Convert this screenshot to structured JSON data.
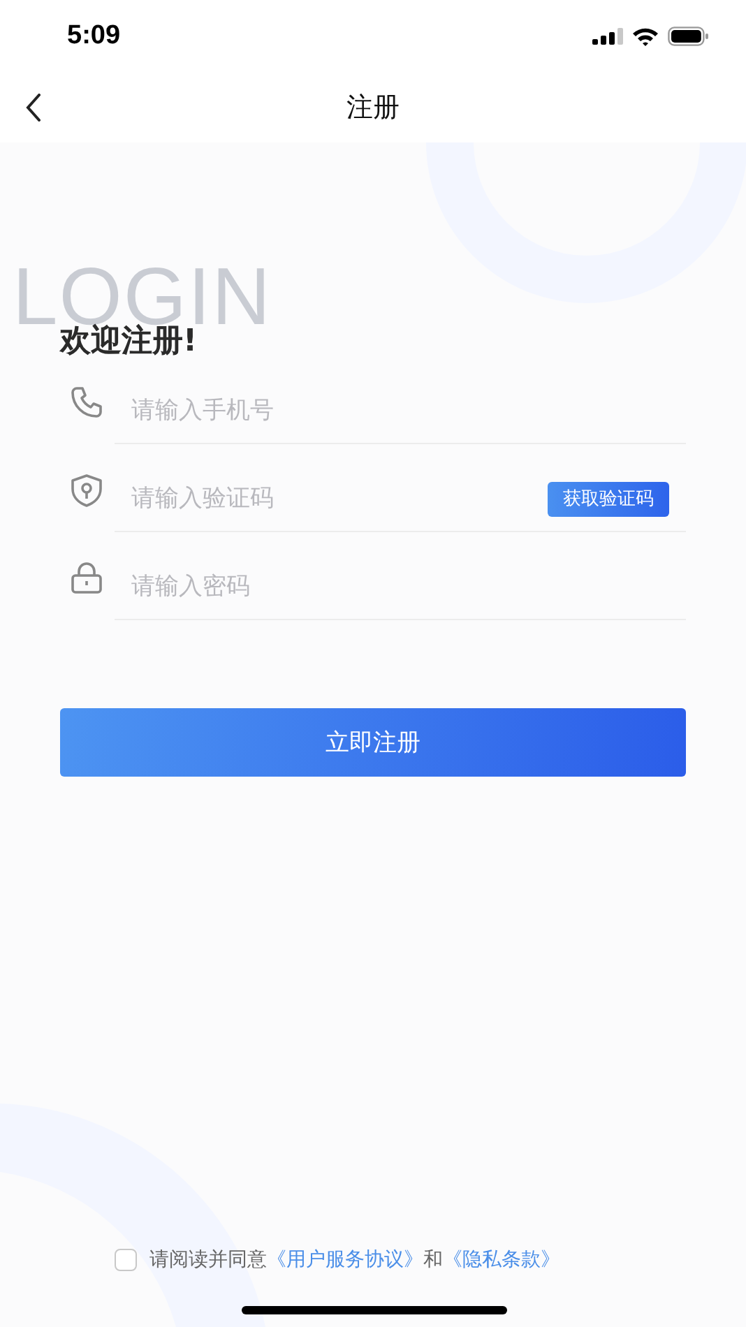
{
  "status_bar": {
    "time": "5:09"
  },
  "nav": {
    "title": "注册"
  },
  "background_text": "LOGIN",
  "heading": "欢迎注册!",
  "fields": [
    {
      "kind": "phone",
      "placeholder": "请输入手机号"
    },
    {
      "kind": "code",
      "placeholder": "请输入验证码",
      "action": "获取验证码"
    },
    {
      "kind": "password",
      "placeholder": "请输入密码"
    }
  ],
  "submit": "立即注册",
  "agreement": {
    "checked": false,
    "text": "请阅读并同意",
    "links": [
      "《用户服务协议》",
      "《隐私条款》"
    ],
    "joiner": "和"
  }
}
